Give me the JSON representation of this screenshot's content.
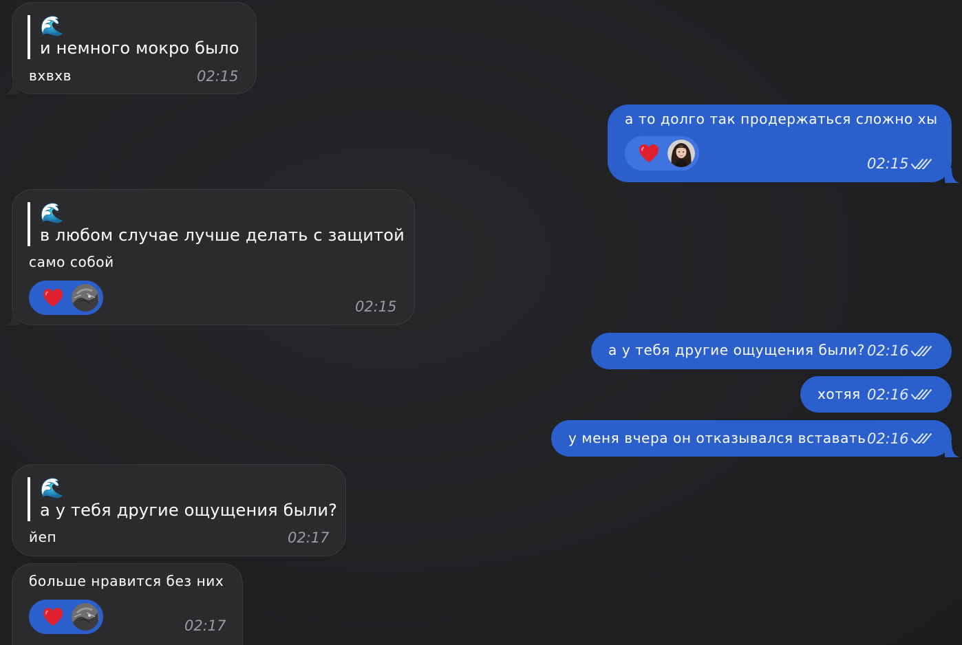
{
  "colors": {
    "background": "#1f2022",
    "incoming_bubble": "#2b2b2d",
    "outgoing_bubble": "#2a5fcc",
    "reaction_pill": "#2a5fcc",
    "timestamp_incoming": "#9a9aa0"
  },
  "messages": [
    {
      "direction": "incoming",
      "reply_quote": {
        "emoji": "🌊",
        "text": "и немного мокро было"
      },
      "text": "вхвхв",
      "time": "02:15"
    },
    {
      "direction": "outgoing",
      "text": "а то долго так продержаться сложно хы",
      "reaction": {
        "emoji": "heart-icon",
        "avatar": "avatar-girl"
      },
      "time": "02:15",
      "status": "read-double-check"
    },
    {
      "direction": "incoming",
      "reply_quote": {
        "emoji": "🌊",
        "text": "в любом случае лучше делать с защитой"
      },
      "text": "само собой",
      "reaction": {
        "emoji": "heart-icon",
        "avatar": "avatar-cat"
      },
      "time": "02:15"
    },
    {
      "direction": "outgoing",
      "text": "а у тебя другие ощущения были?",
      "time": "02:16",
      "status": "read-double-check"
    },
    {
      "direction": "outgoing",
      "text": "хотяя",
      "time": "02:16",
      "status": "read-double-check"
    },
    {
      "direction": "outgoing",
      "text": "у меня вчера он отказывался вставать",
      "time": "02:16",
      "status": "read-double-check"
    },
    {
      "direction": "incoming",
      "reply_quote": {
        "emoji": "🌊",
        "text": "а у тебя другие ощущения были?"
      },
      "text": "йеп",
      "time": "02:17"
    },
    {
      "direction": "incoming",
      "text": "больше нравится без них",
      "reaction": {
        "emoji": "heart-icon",
        "avatar": "avatar-cat"
      },
      "time": "02:17"
    }
  ]
}
